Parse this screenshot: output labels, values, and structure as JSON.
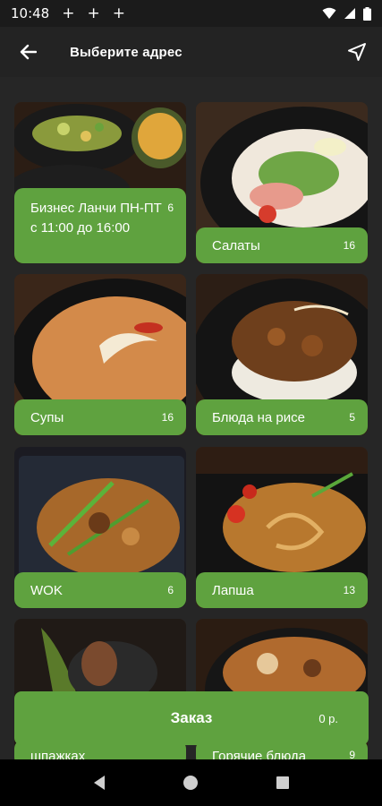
{
  "status_bar": {
    "time": "10:48",
    "notifications": [
      "+",
      "+",
      "+"
    ],
    "icons": [
      "wifi-icon",
      "cell-signal-icon",
      "battery-icon"
    ]
  },
  "toolbar": {
    "title": "Выберите адрес",
    "back_icon": "arrow-left-icon",
    "location_icon": "navigation-arrow-icon"
  },
  "categories": [
    {
      "name": "Бизнес Ланчи ПН-ПТ с 11:00 до 16:00",
      "count": "6"
    },
    {
      "name": "Салаты",
      "count": "16"
    },
    {
      "name": "Супы",
      "count": "16"
    },
    {
      "name": "Блюда на рисе",
      "count": "5"
    },
    {
      "name": "WOK",
      "count": "6"
    },
    {
      "name": "Лапша",
      "count": "13"
    },
    {
      "name": "шпажках",
      "count": ""
    },
    {
      "name": "Горячие блюда",
      "count": "9"
    }
  ],
  "order": {
    "label": "Заказ",
    "total": "0 р."
  },
  "nav_bar": {
    "icons": [
      "back-triangle-icon",
      "home-circle-icon",
      "recents-square-icon"
    ]
  },
  "colors": {
    "accent": "#5fa23f",
    "background": "#262626",
    "toolbar": "#232323"
  }
}
